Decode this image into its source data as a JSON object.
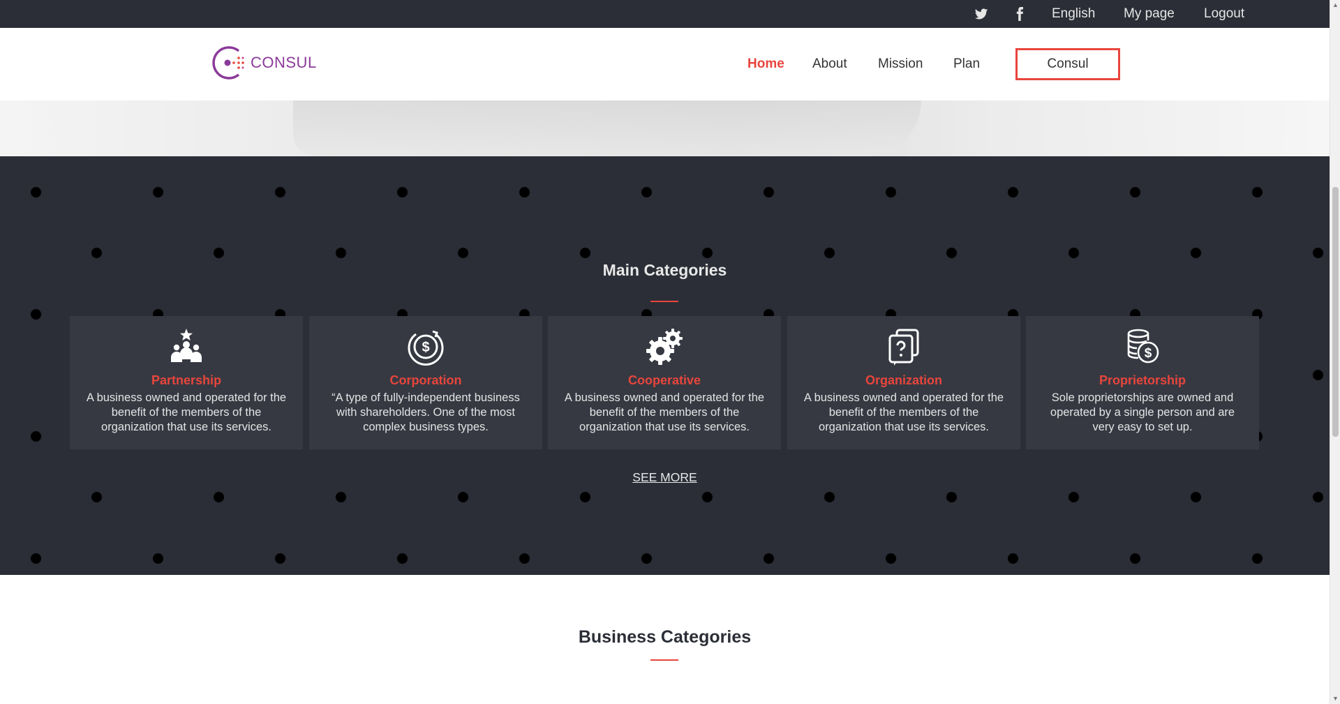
{
  "topbar": {
    "icons": [
      "twitter-icon",
      "facebook-icon"
    ],
    "language": "English",
    "my_page": "My page",
    "logout": "Logout"
  },
  "header": {
    "logo_text": "CONSUL",
    "nav": [
      "Home",
      "About",
      "Mission",
      "Plan"
    ],
    "active": "Home",
    "cta": "Consul"
  },
  "main_categories": {
    "title": "Main Categories",
    "cards": [
      {
        "icon": "team-star-icon",
        "title": "Partnership",
        "description": "A business owned and operated for the benefit of the members of the organization that use its services."
      },
      {
        "icon": "dollar-coin-icon",
        "title": "Corporation",
        "description": "“A type of fully-independent business with shareholders. One of the most complex business types."
      },
      {
        "icon": "gears-icon",
        "title": "Cooperative",
        "description": "A business owned and operated for the benefit of the members of the organization that use its services."
      },
      {
        "icon": "question-cards-icon",
        "title": "Organization",
        "description": "A business owned and operated for the benefit of the members of the organization that use its services."
      },
      {
        "icon": "coin-stack-icon",
        "title": "Proprietorship",
        "description": "Sole proprietorships are owned and operated by a single person and are very easy to set up."
      }
    ],
    "see_more": "SEE MORE"
  },
  "business_categories": {
    "title": "Business Categories"
  },
  "colors": {
    "accent": "#e8453c",
    "dark": "#2b2e36",
    "card": "#363942",
    "brand_purple": "#8b3a9a"
  }
}
